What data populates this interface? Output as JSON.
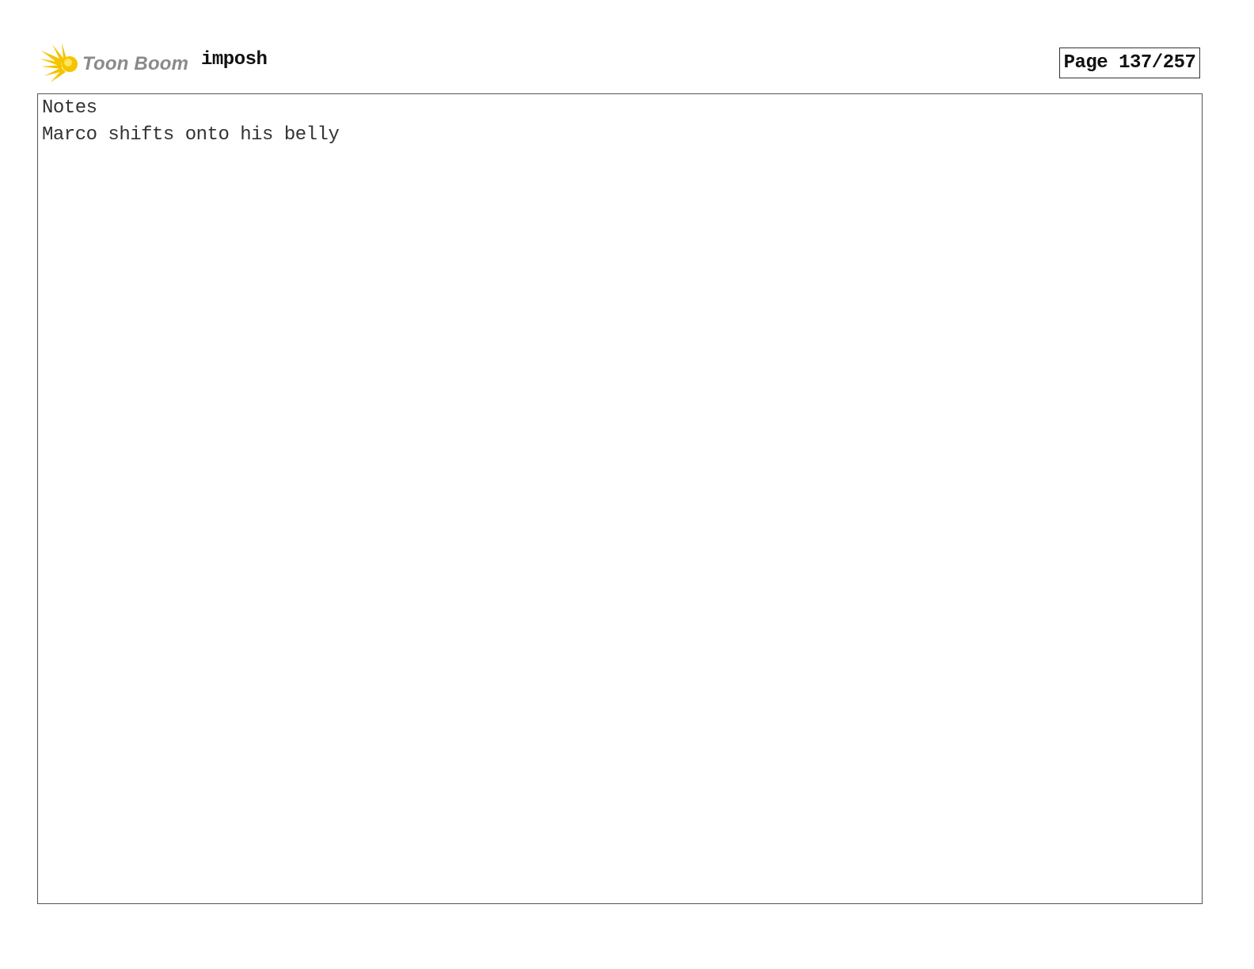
{
  "header": {
    "logo": {
      "icon": "toon-boom-sun-icon",
      "text": "Toon Boom",
      "colors": {
        "sun": "#f5c400",
        "sun_light": "#ffe45c",
        "text": "#8a8a8a"
      }
    },
    "project_name": "imposh",
    "page_indicator": "Page 137/257"
  },
  "notes": {
    "label": "Notes",
    "text": "Marco shifts onto his belly"
  }
}
